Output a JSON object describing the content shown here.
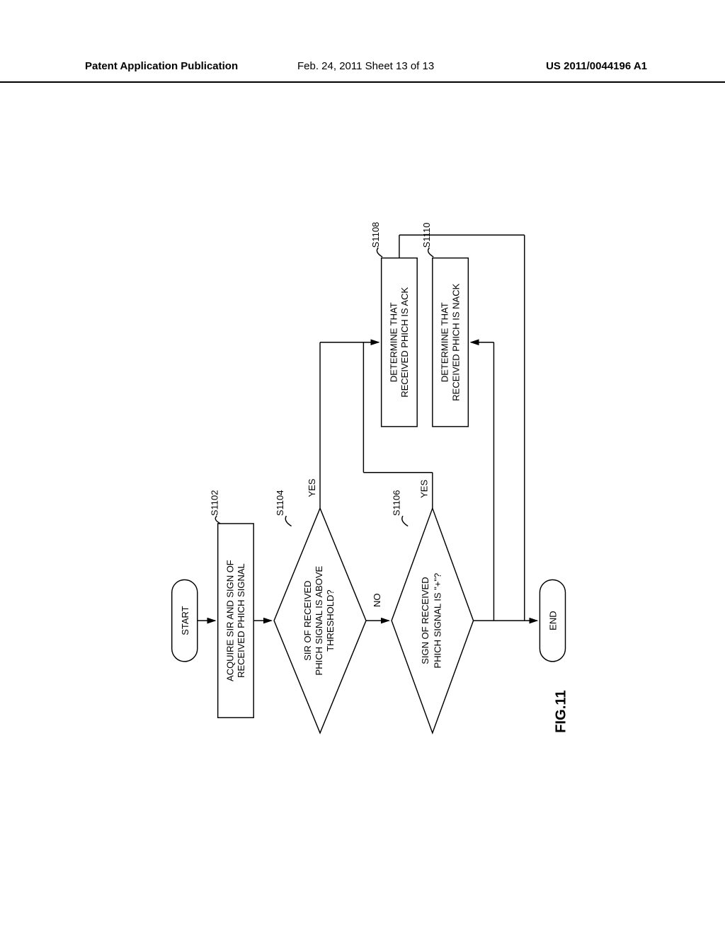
{
  "header": {
    "left": "Patent Application Publication",
    "center": "Feb. 24, 2011  Sheet 13 of 13",
    "right": "US 2011/0044196 A1"
  },
  "figure_label": "FIG.11",
  "chart_data": {
    "type": "flowchart",
    "nodes": [
      {
        "id": "start",
        "type": "terminal",
        "text": "START"
      },
      {
        "id": "s1102",
        "type": "process",
        "text": "ACQUIRE SIR AND SIGN OF\nRECEIVED PHICH SIGNAL",
        "ref": "S1102"
      },
      {
        "id": "s1104",
        "type": "decision",
        "text": "SIR OF RECEIVED\nPHICH SIGNAL IS ABOVE\nTHRESHOLD?",
        "ref": "S1104"
      },
      {
        "id": "s1106",
        "type": "decision",
        "text": "SIGN OF RECEIVED\nPHICH SIGNAL IS \"+\"?",
        "ref": "S1106"
      },
      {
        "id": "s1108",
        "type": "process",
        "text": "DETERMINE THAT\nRECEIVED PHICH IS ACK",
        "ref": "S1108"
      },
      {
        "id": "s1110",
        "type": "process",
        "text": "DETERMINE THAT\nRECEIVED PHICH IS NACK",
        "ref": "S1110"
      },
      {
        "id": "end",
        "type": "terminal",
        "text": "END"
      }
    ],
    "edges": [
      {
        "from": "start",
        "to": "s1102"
      },
      {
        "from": "s1102",
        "to": "s1104"
      },
      {
        "from": "s1104",
        "to": "s1106",
        "label": "NO"
      },
      {
        "from": "s1104",
        "to": "s1108",
        "label": "YES"
      },
      {
        "from": "s1106",
        "to": "s1108",
        "label": "YES"
      },
      {
        "from": "s1106",
        "to": "s1110",
        "label": "NO"
      },
      {
        "from": "s1108",
        "to": "end"
      },
      {
        "from": "s1110",
        "to": "end"
      }
    ]
  },
  "labels": {
    "yes": "YES",
    "no": "NO"
  }
}
